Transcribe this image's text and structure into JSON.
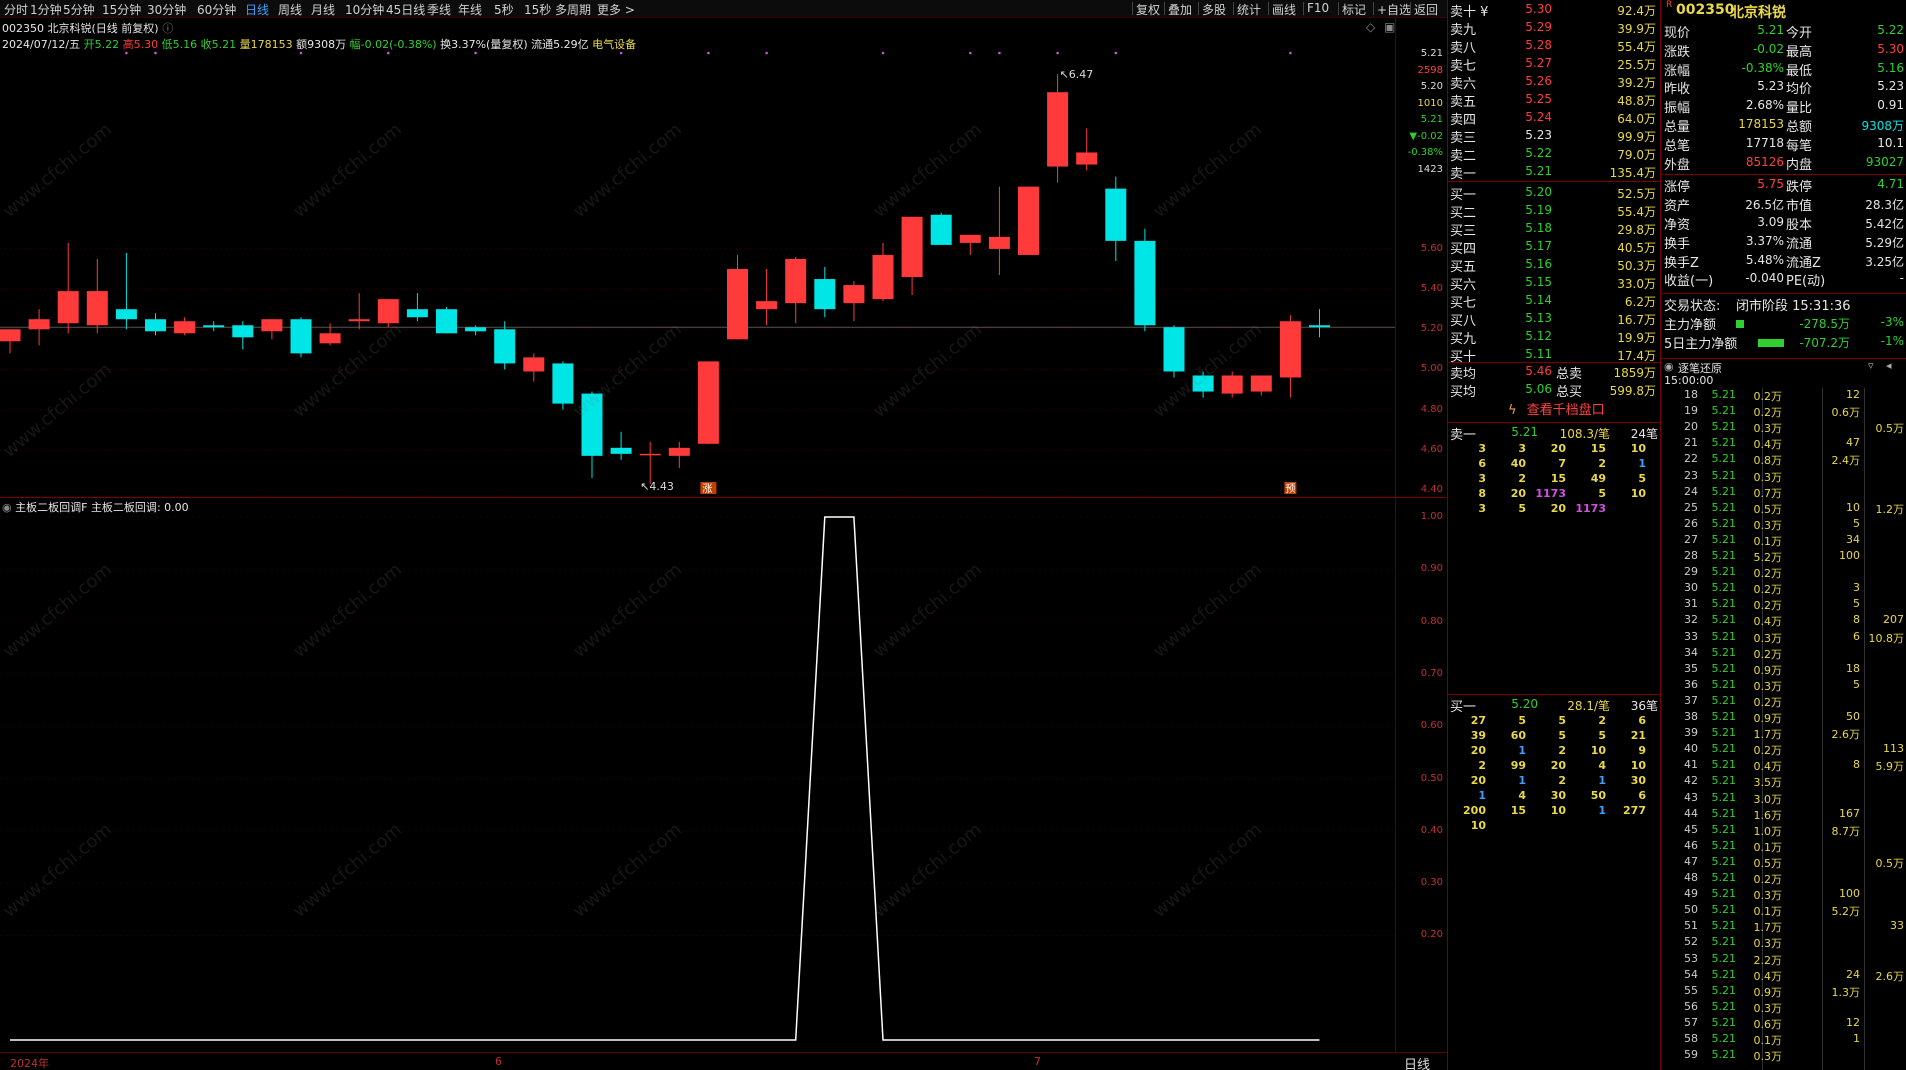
{
  "toolbar": {
    "tabs": [
      "分时",
      "1分钟",
      "5分钟",
      "15分钟",
      "30分钟",
      "60分钟",
      "日线",
      "周线",
      "月线",
      "10分钟",
      "45日线",
      "季线",
      "年线",
      "5秒",
      "15秒",
      "多周期",
      "更多 >"
    ],
    "active_tab": "日线",
    "right_buttons": [
      "复权",
      "叠加",
      "多股",
      "统计",
      "画线",
      "F10",
      "标记",
      "+自选",
      "返回"
    ]
  },
  "stock": {
    "code": "002350",
    "name": "北京科锐"
  },
  "chart_header": {
    "title": "002350 北京科锐(日线 前复权)",
    "date": "2024/07/12/五",
    "open": "开5.22",
    "high": "高5.30",
    "low": "低5.16",
    "close": "收5.21",
    "volume": "量178153",
    "amount": "额9308万",
    "change": "幅-0.02(-0.38%)",
    "turnover": "换3.37%(量复权)",
    "float": "流通5.29亿",
    "sector": "电气设备"
  },
  "chart_data": {
    "type": "candlestick",
    "title": "002350 北京科锐(日线 前复权)",
    "y_axis_ticks": [
      "5.60",
      "5.40",
      "5.20",
      "5.00",
      "4.80",
      "4.60",
      "4.40"
    ],
    "ylim": [
      4.4,
      6.6
    ],
    "x_labels": [
      {
        "label": "2024年",
        "index": 0
      },
      {
        "label": "6",
        "index": 17
      },
      {
        "label": "7",
        "index": 36
      }
    ],
    "bars": [
      {
        "o": 5.14,
        "h": 5.2,
        "l": 5.08,
        "c": 5.2
      },
      {
        "o": 5.2,
        "h": 5.3,
        "l": 5.12,
        "c": 5.25
      },
      {
        "o": 5.23,
        "h": 5.63,
        "l": 5.18,
        "c": 5.39
      },
      {
        "o": 5.22,
        "h": 5.55,
        "l": 5.18,
        "c": 5.39
      },
      {
        "o": 5.3,
        "h": 5.58,
        "l": 5.2,
        "c": 5.25
      },
      {
        "o": 5.25,
        "h": 5.28,
        "l": 5.17,
        "c": 5.19
      },
      {
        "o": 5.18,
        "h": 5.26,
        "l": 5.17,
        "c": 5.24
      },
      {
        "o": 5.22,
        "h": 5.24,
        "l": 5.19,
        "c": 5.21
      },
      {
        "o": 5.22,
        "h": 5.24,
        "l": 5.1,
        "c": 5.16
      },
      {
        "o": 5.19,
        "h": 5.25,
        "l": 5.15,
        "c": 5.25
      },
      {
        "o": 5.25,
        "h": 5.26,
        "l": 5.06,
        "c": 5.08
      },
      {
        "o": 5.13,
        "h": 5.23,
        "l": 5.12,
        "c": 5.18
      },
      {
        "o": 5.24,
        "h": 5.38,
        "l": 5.2,
        "c": 5.25
      },
      {
        "o": 5.23,
        "h": 5.33,
        "l": 5.21,
        "c": 5.35
      },
      {
        "o": 5.3,
        "h": 5.38,
        "l": 5.24,
        "c": 5.26
      },
      {
        "o": 5.3,
        "h": 5.31,
        "l": 5.18,
        "c": 5.18
      },
      {
        "o": 5.21,
        "h": 5.22,
        "l": 5.17,
        "c": 5.19
      },
      {
        "o": 5.2,
        "h": 5.24,
        "l": 5.0,
        "c": 5.03
      },
      {
        "o": 4.99,
        "h": 5.08,
        "l": 4.94,
        "c": 5.06
      },
      {
        "o": 5.03,
        "h": 5.04,
        "l": 4.8,
        "c": 4.83
      },
      {
        "o": 4.88,
        "h": 4.89,
        "l": 4.46,
        "c": 4.57
      },
      {
        "o": 4.61,
        "h": 4.69,
        "l": 4.55,
        "c": 4.58
      },
      {
        "o": 4.58,
        "h": 4.64,
        "l": 4.43,
        "c": 4.58
      },
      {
        "o": 4.57,
        "h": 4.64,
        "l": 4.51,
        "c": 4.61
      },
      {
        "o": 4.63,
        "h": 5.04,
        "l": 4.63,
        "c": 5.04
      },
      {
        "o": 5.15,
        "h": 5.57,
        "l": 5.15,
        "c": 5.5
      },
      {
        "o": 5.3,
        "h": 5.5,
        "l": 5.22,
        "c": 5.34
      },
      {
        "o": 5.33,
        "h": 5.56,
        "l": 5.23,
        "c": 5.55
      },
      {
        "o": 5.45,
        "h": 5.51,
        "l": 5.26,
        "c": 5.3
      },
      {
        "o": 5.33,
        "h": 5.44,
        "l": 5.24,
        "c": 5.42
      },
      {
        "o": 5.35,
        "h": 5.63,
        "l": 5.34,
        "c": 5.57
      },
      {
        "o": 5.46,
        "h": 5.76,
        "l": 5.37,
        "c": 5.76
      },
      {
        "o": 5.77,
        "h": 5.78,
        "l": 5.66,
        "c": 5.62
      },
      {
        "o": 5.63,
        "h": 5.66,
        "l": 5.57,
        "c": 5.67
      },
      {
        "o": 5.6,
        "h": 5.91,
        "l": 5.47,
        "c": 5.66
      },
      {
        "o": 5.57,
        "h": 5.89,
        "l": 5.57,
        "c": 5.91
      },
      {
        "o": 6.01,
        "h": 6.47,
        "l": 5.93,
        "c": 6.38
      },
      {
        "o": 6.02,
        "h": 6.2,
        "l": 5.99,
        "c": 6.08
      },
      {
        "o": 5.9,
        "h": 5.96,
        "l": 5.54,
        "c": 5.64
      },
      {
        "o": 5.64,
        "h": 5.7,
        "l": 5.19,
        "c": 5.22
      },
      {
        "o": 5.21,
        "h": 5.22,
        "l": 4.96,
        "c": 4.99
      },
      {
        "o": 4.97,
        "h": 4.99,
        "l": 4.86,
        "c": 4.89
      },
      {
        "o": 4.88,
        "h": 4.99,
        "l": 4.86,
        "c": 4.97
      },
      {
        "o": 4.89,
        "h": 4.97,
        "l": 4.87,
        "c": 4.97
      },
      {
        "o": 4.96,
        "h": 5.27,
        "l": 4.86,
        "c": 5.24
      },
      {
        "o": 5.22,
        "h": 5.3,
        "l": 5.16,
        "c": 5.21
      }
    ],
    "annotations": {
      "high": "6.47",
      "low": "4.43",
      "limit_up_tag": "涨",
      "yu_tag": "预"
    },
    "indicator": {
      "title": "主板二板回调F",
      "label": "主板二板回调",
      "value": "0.00",
      "y_axis_ticks": [
        "1.00",
        "0.90",
        "0.80",
        "0.70",
        "0.60",
        "0.50",
        "0.40",
        "0.30",
        "0.20"
      ],
      "ylim": [
        0,
        1.0
      ],
      "values": [
        0,
        0,
        0,
        0,
        0,
        0,
        0,
        0,
        0,
        0,
        0,
        0,
        0,
        0,
        0,
        0,
        0,
        0,
        0,
        0,
        0,
        0,
        0,
        0,
        0,
        0,
        0,
        0,
        1,
        1,
        0,
        0,
        0,
        0,
        0,
        0,
        0,
        0,
        0,
        0,
        0,
        0,
        0,
        0,
        0,
        0
      ]
    }
  },
  "price_mini_axis": [
    "5.21",
    "2598",
    "5.20",
    "1010",
    "5.21",
    "▼-0.02",
    "-0.38%",
    "1423"
  ],
  "bottom_bar": {
    "year": "2024年",
    "m6": "6",
    "m7": "7",
    "period": "日线"
  },
  "order_book": {
    "sells": [
      {
        "label": "卖十 ¥",
        "price": "5.30",
        "vol": "92.4万"
      },
      {
        "label": "卖九",
        "price": "5.29",
        "vol": "39.9万"
      },
      {
        "label": "卖八",
        "price": "5.28",
        "vol": "55.4万"
      },
      {
        "label": "卖七",
        "price": "5.27",
        "vol": "25.5万"
      },
      {
        "label": "卖六",
        "price": "5.26",
        "vol": "39.2万"
      },
      {
        "label": "卖五",
        "price": "5.25",
        "vol": "48.8万"
      },
      {
        "label": "卖四",
        "price": "5.24",
        "vol": "64.0万"
      },
      {
        "label": "卖三",
        "price": "5.23",
        "vol": "99.9万"
      },
      {
        "label": "卖二",
        "price": "5.22",
        "vol": "79.0万"
      },
      {
        "label": "卖一",
        "price": "5.21",
        "vol": "135.4万"
      }
    ],
    "buys": [
      {
        "label": "买一",
        "price": "5.20",
        "vol": "52.5万"
      },
      {
        "label": "买二",
        "price": "5.19",
        "vol": "55.4万"
      },
      {
        "label": "买三",
        "price": "5.18",
        "vol": "29.8万"
      },
      {
        "label": "买四",
        "price": "5.17",
        "vol": "40.5万"
      },
      {
        "label": "买五",
        "price": "5.16",
        "vol": "50.3万"
      },
      {
        "label": "买六",
        "price": "5.15",
        "vol": "33.0万"
      },
      {
        "label": "买七",
        "price": "5.14",
        "vol": "6.2万"
      },
      {
        "label": "买八",
        "price": "5.13",
        "vol": "16.7万"
      },
      {
        "label": "买九",
        "price": "5.12",
        "vol": "19.9万"
      },
      {
        "label": "买十",
        "price": "5.11",
        "vol": "17.4万"
      }
    ],
    "avg_sell_label": "卖均",
    "avg_sell": "5.46",
    "total_sell_label": "总卖",
    "total_sell": "1859万",
    "avg_buy_label": "买均",
    "avg_buy": "5.06",
    "total_buy_label": "总买",
    "total_buy": "599.8万",
    "thousand_link": "查看千档盘口"
  },
  "queue_sell": {
    "label": "卖一",
    "price": "5.21",
    "per": "108.3/笔",
    "count": "24笔",
    "rows": [
      [
        "3",
        "3",
        "20",
        "15",
        "10"
      ],
      [
        "6",
        "40",
        "7",
        "2",
        "1"
      ],
      [
        "3",
        "2",
        "15",
        "49",
        "5"
      ],
      [
        "8",
        "20",
        "1173",
        "5",
        "10"
      ],
      [
        "3",
        "5",
        "20",
        "1173",
        ""
      ]
    ]
  },
  "queue_buy": {
    "label": "买一",
    "price": "5.20",
    "per": "28.1/笔",
    "count": "36笔",
    "rows": [
      [
        "27",
        "5",
        "5",
        "2",
        "6"
      ],
      [
        "39",
        "60",
        "5",
        "5",
        "21"
      ],
      [
        "20",
        "1",
        "2",
        "10",
        "9"
      ],
      [
        "2",
        "99",
        "20",
        "4",
        "10"
      ],
      [
        "20",
        "1",
        "2",
        "1",
        "30"
      ],
      [
        "1",
        "4",
        "30",
        "50",
        "6"
      ],
      [
        "200",
        "15",
        "10",
        "1",
        "277"
      ],
      [
        "10",
        "",
        "",
        "",
        ""
      ]
    ]
  },
  "quote": {
    "badge": "R",
    "rows": [
      {
        "l1": "现价",
        "v1": "5.21",
        "l2": "今开",
        "v2": "5.22"
      },
      {
        "l1": "涨跌",
        "v1": "-0.02",
        "l2": "最高",
        "v2": "5.30"
      },
      {
        "l1": "涨幅",
        "v1": "-0.38%",
        "l2": "最低",
        "v2": "5.16"
      },
      {
        "l1": "昨收",
        "v1": "5.23",
        "l2": "均价",
        "v2": "5.23"
      },
      {
        "l1": "振幅",
        "v1": "2.68%",
        "l2": "量比",
        "v2": "0.91"
      },
      {
        "l1": "总量",
        "v1": "178153",
        "l2": "总额",
        "v2": "9308万"
      },
      {
        "l1": "总笔",
        "v1": "17718",
        "l2": "每笔",
        "v2": "10.1"
      },
      {
        "l1": "外盘",
        "v1": "85126",
        "l2": "内盘",
        "v2": "93027"
      }
    ],
    "rows2": [
      {
        "l1": "涨停",
        "v1": "5.75",
        "l2": "跌停",
        "v2": "4.71"
      },
      {
        "l1": "资产",
        "v1": "26.5亿",
        "l2": "市值",
        "v2": "28.3亿"
      },
      {
        "l1": "净资",
        "v1": "3.09",
        "l2": "股本",
        "v2": "5.42亿"
      },
      {
        "l1": "换手",
        "v1": "3.37%",
        "l2": "流通",
        "v2": "5.29亿"
      },
      {
        "l1": "换手Z",
        "v1": "5.48%",
        "l2": "流通Z",
        "v2": "3.25亿"
      },
      {
        "l1": "收益(一)",
        "v1": "-0.040",
        "l2": "PE(动)",
        "v2": "-"
      }
    ],
    "status_label": "交易状态:",
    "status": "闭市阶段 15:31:36",
    "flow1_label": "主力净额",
    "flow1": "-278.5万",
    "flow1_pct": "-3%",
    "flow2_label": "5日主力净额",
    "flow2": "-707.2万",
    "flow2_pct": "-1%"
  },
  "tick": {
    "title": "逐笔还原",
    "first_time": "15:00:00",
    "rows": [
      {
        "t": "18",
        "p": "5.21",
        "v": "0.2万",
        "a": "12",
        "b": ""
      },
      {
        "t": "19",
        "p": "5.21",
        "v": "0.2万",
        "a": "0.6万",
        "b": ""
      },
      {
        "t": "20",
        "p": "5.21",
        "v": "0.3万",
        "a": "",
        "b": "0.5万"
      },
      {
        "t": "21",
        "p": "5.21",
        "v": "0.4万",
        "a": "47",
        "b": ""
      },
      {
        "t": "22",
        "p": "5.21",
        "v": "0.8万",
        "a": "2.4万",
        "b": ""
      },
      {
        "t": "23",
        "p": "5.21",
        "v": "0.3万",
        "a": "",
        "b": ""
      },
      {
        "t": "24",
        "p": "5.21",
        "v": "0.7万",
        "a": "",
        "b": ""
      },
      {
        "t": "25",
        "p": "5.21",
        "v": "0.5万",
        "a": "10",
        "b": "1.2万"
      },
      {
        "t": "26",
        "p": "5.21",
        "v": "0.3万",
        "a": "5",
        "b": ""
      },
      {
        "t": "27",
        "p": "5.21",
        "v": "0.1万",
        "a": "34",
        "b": ""
      },
      {
        "t": "28",
        "p": "5.21",
        "v": "5.2万",
        "a": "100",
        "b": ""
      },
      {
        "t": "29",
        "p": "5.21",
        "v": "0.2万",
        "a": "",
        "b": ""
      },
      {
        "t": "30",
        "p": "5.21",
        "v": "0.2万",
        "a": "3",
        "b": ""
      },
      {
        "t": "31",
        "p": "5.21",
        "v": "0.2万",
        "a": "5",
        "b": ""
      },
      {
        "t": "32",
        "p": "5.21",
        "v": "0.4万",
        "a": "8",
        "b": "207"
      },
      {
        "t": "33",
        "p": "5.21",
        "v": "0.3万",
        "a": "6",
        "b": "10.8万"
      },
      {
        "t": "34",
        "p": "5.21",
        "v": "0.2万",
        "a": "",
        "b": ""
      },
      {
        "t": "35",
        "p": "5.21",
        "v": "0.9万",
        "a": "18",
        "b": ""
      },
      {
        "t": "36",
        "p": "5.21",
        "v": "0.3万",
        "a": "5",
        "b": ""
      },
      {
        "t": "37",
        "p": "5.21",
        "v": "0.2万",
        "a": "",
        "b": ""
      },
      {
        "t": "38",
        "p": "5.21",
        "v": "0.9万",
        "a": "50",
        "b": ""
      },
      {
        "t": "39",
        "p": "5.21",
        "v": "1.7万",
        "a": "2.6万",
        "b": ""
      },
      {
        "t": "40",
        "p": "5.21",
        "v": "0.2万",
        "a": "",
        "b": "113"
      },
      {
        "t": "41",
        "p": "5.21",
        "v": "0.4万",
        "a": "8",
        "b": "5.9万"
      },
      {
        "t": "42",
        "p": "5.21",
        "v": "3.5万",
        "a": "",
        "b": ""
      },
      {
        "t": "43",
        "p": "5.21",
        "v": "3.0万",
        "a": "",
        "b": ""
      },
      {
        "t": "44",
        "p": "5.21",
        "v": "1.6万",
        "a": "167",
        "b": ""
      },
      {
        "t": "45",
        "p": "5.21",
        "v": "1.0万",
        "a": "8.7万",
        "b": ""
      },
      {
        "t": "46",
        "p": "5.21",
        "v": "0.1万",
        "a": "",
        "b": ""
      },
      {
        "t": "47",
        "p": "5.21",
        "v": "0.5万",
        "a": "",
        "b": "0.5万"
      },
      {
        "t": "48",
        "p": "5.21",
        "v": "0.2万",
        "a": "",
        "b": ""
      },
      {
        "t": "49",
        "p": "5.21",
        "v": "0.3万",
        "a": "100",
        "b": ""
      },
      {
        "t": "50",
        "p": "5.21",
        "v": "0.1万",
        "a": "5.2万",
        "b": ""
      },
      {
        "t": "51",
        "p": "5.21",
        "v": "1.7万",
        "a": "",
        "b": "33"
      },
      {
        "t": "52",
        "p": "5.21",
        "v": "0.3万",
        "a": "",
        "b": ""
      },
      {
        "t": "53",
        "p": "5.21",
        "v": "2.2万",
        "a": "",
        "b": ""
      },
      {
        "t": "54",
        "p": "5.21",
        "v": "0.4万",
        "a": "24",
        "b": "2.6万"
      },
      {
        "t": "55",
        "p": "5.21",
        "v": "0.9万",
        "a": "1.3万",
        "b": ""
      },
      {
        "t": "56",
        "p": "5.21",
        "v": "0.3万",
        "a": "",
        "b": ""
      },
      {
        "t": "57",
        "p": "5.21",
        "v": "0.6万",
        "a": "12",
        "b": ""
      },
      {
        "t": "58",
        "p": "5.21",
        "v": "0.1万",
        "a": "1",
        "b": ""
      },
      {
        "t": "59",
        "p": "5.21",
        "v": "0.3万",
        "a": "",
        "b": ""
      }
    ]
  },
  "watermark": "www.cfchi.com",
  "colors": {
    "up": "#ff3a3a",
    "down": "#00e5e5",
    "bg": "#000000",
    "grid": "#3a0000",
    "accent": "#3aa0ff"
  }
}
